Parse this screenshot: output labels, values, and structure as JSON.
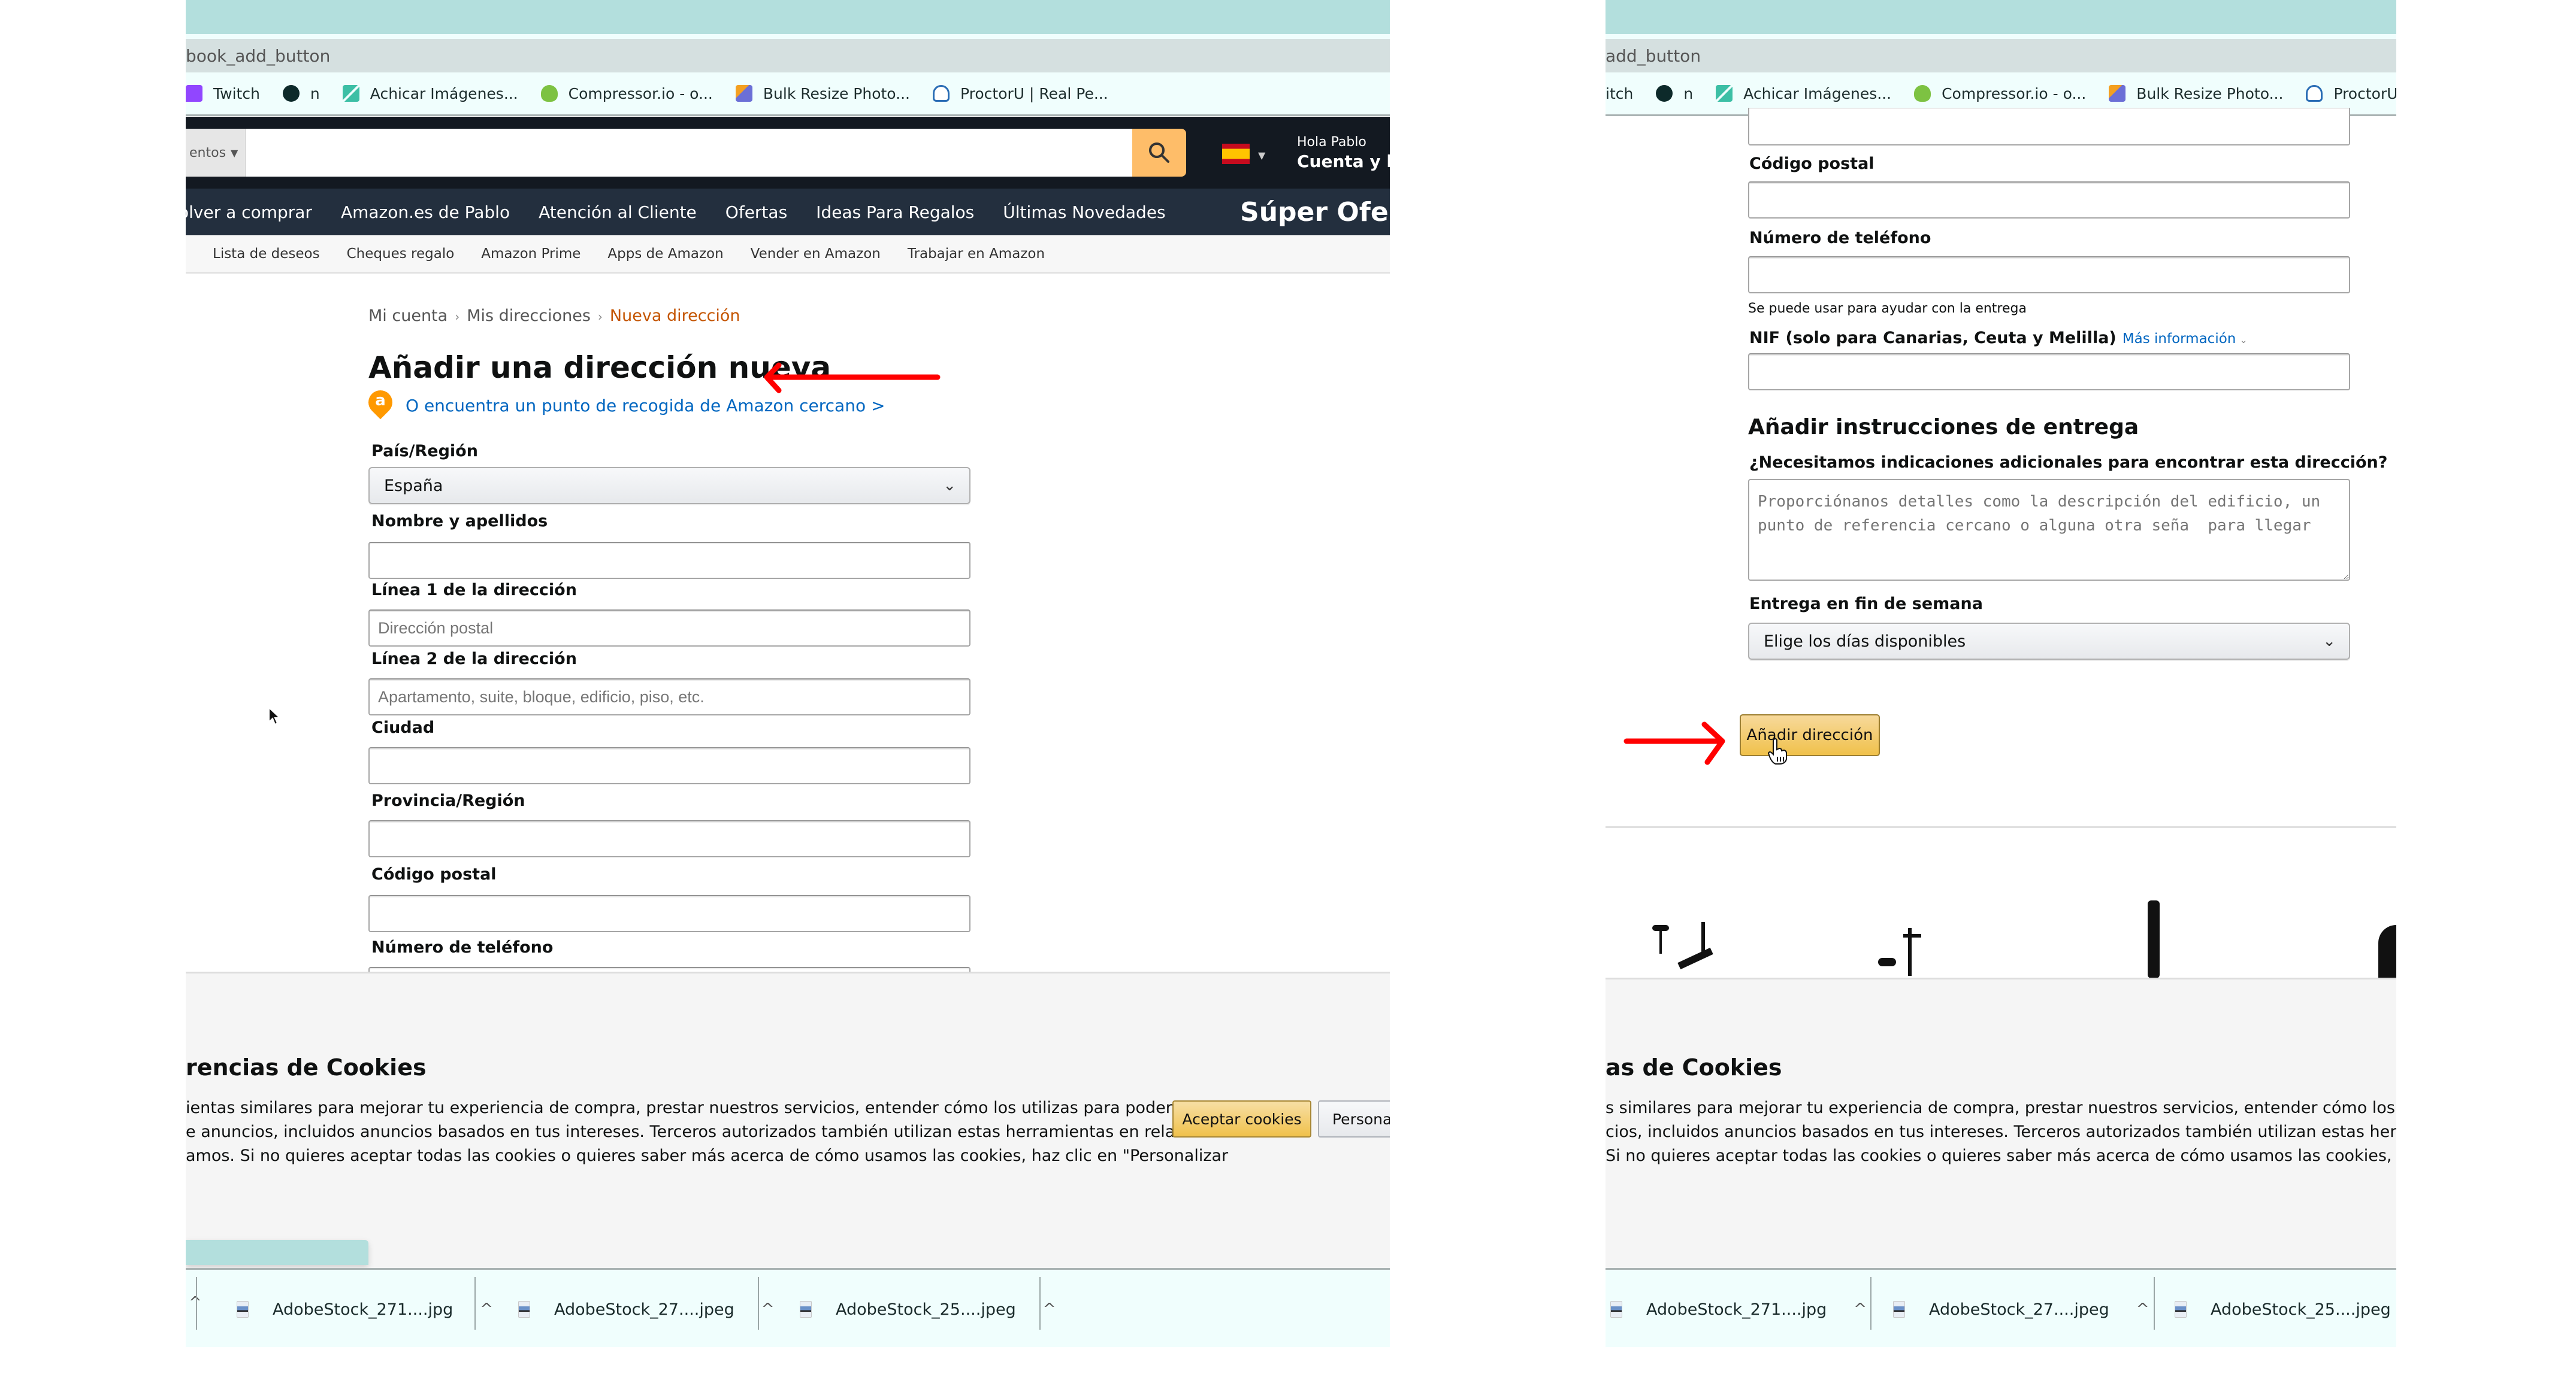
{
  "browser": {
    "url_fragment_left": "book_add_button",
    "url_fragment_right": "add_button",
    "bookmarks": [
      {
        "icon": "twitch-icon",
        "label": "Twitch"
      },
      {
        "icon": "globe-icon",
        "label": "n"
      },
      {
        "icon": "compress-arrows-icon",
        "label": "Achicar Imágenes..."
      },
      {
        "icon": "chameleon-icon",
        "label": "Compressor.io - o..."
      },
      {
        "icon": "stacked-pages-icon",
        "label": "Bulk Resize Photo..."
      },
      {
        "icon": "owl-icon",
        "label": "ProctorU | Real Pe..."
      }
    ],
    "bookmarks_right_first": "itch",
    "bookmarks_right_last": "ProctorU | Real"
  },
  "header": {
    "search_category": "entos",
    "search_placeholder": "",
    "greeting": "Hola Pablo",
    "account_label": "Cuenta y listas",
    "nav": [
      "olver a comprar",
      "Amazon.es de Pablo",
      "Atención al Cliente",
      "Ofertas",
      "Ideas Para Regalos",
      "Últimas Novedades"
    ],
    "promo": "Súper Ofertas",
    "subnav": [
      "Lista de deseos",
      "Cheques regalo",
      "Amazon Prime",
      "Apps de Amazon",
      "Vender en Amazon",
      "Trabajar en Amazon"
    ]
  },
  "breadcrumb": {
    "items": [
      "Mi cuenta",
      "Mis direcciones"
    ],
    "current": "Nueva dirección",
    "separator": "›"
  },
  "page": {
    "title": "Añadir una dirección nueva",
    "pickup_link": "O encuentra un punto de recogida de Amazon cercano >",
    "pickup_icon_letter": "a"
  },
  "form_left": {
    "country_label": "País/Región",
    "country_value": "España",
    "name_label": "Nombre y apellidos",
    "name_value": "",
    "address1_label": "Línea 1 de la dirección",
    "address1_placeholder": "Dirección postal",
    "address2_label": "Línea 2 de la dirección",
    "address2_placeholder": "Apartamento, suite, bloque, edificio, piso, etc.",
    "city_label": "Ciudad",
    "city_value": "",
    "province_label": "Provincia/Región",
    "province_value": "",
    "postal_label": "Código postal",
    "postal_value": "",
    "phone_label": "Número de teléfono"
  },
  "form_right": {
    "postal_label": "Código postal",
    "phone_label": "Número de teléfono",
    "phone_note": "Se puede usar para ayudar con la entrega",
    "nif_label": "NIF (solo para Canarias, Ceuta y Melilla)",
    "nif_more": "Más información",
    "instructions_title": "Añadir instrucciones de entrega",
    "instructions_question": "¿Necesitamos indicaciones adicionales para encontrar esta dirección?",
    "instructions_placeholder": "Proporciónanos detalles como la descripción del edificio, un punto de referencia cercano o alguna otra seña  para llegar",
    "weekend_label": "Entrega en fin de semana",
    "weekend_value": "Elige los días disponibles",
    "submit_label": "Añadir dirección"
  },
  "cookies": {
    "title_left": "rencias de Cookies",
    "title_right": "as de Cookies",
    "lines_left": [
      "ientas similares para mejorar tu experiencia de compra, prestar nuestros servicios, entender cómo los utilizas para poder",
      "e anuncios, incluidos anuncios basados en tus intereses. Terceros autorizados también utilizan estas herramientas en relación",
      "amos. Si no quieres aceptar todas las cookies o quieres saber más acerca de cómo usamos las cookies, haz clic en \"Personalizar"
    ],
    "lines_right": [
      "s similares para mejorar tu experiencia de compra, prestar nuestros servicios, entender cómo los utilizas p",
      "cios, incluidos anuncios basados en tus intereses. Terceros autorizados también utilizan estas herramient",
      "Si no quieres aceptar todas las cookies o quieres saber más acerca de cómo usamos las cookies, haz clic e"
    ],
    "accept_label": "Aceptar cookies",
    "customize_label": "Personalizar"
  },
  "downloads": [
    {
      "name": "AdobeStock_271....jpg"
    },
    {
      "name": "AdobeStock_27....jpeg"
    },
    {
      "name": "AdobeStock_25....jpeg"
    }
  ],
  "colors": {
    "header_bg": "#131921",
    "nav_bg": "#232f3e",
    "search_button": "#febd69",
    "link": "#0066c0",
    "breadcrumb_current": "#c45500",
    "primary_button": "#f0c14b",
    "annotation_arrow": "#ff0000",
    "chrome_teal": "#b3dfdd"
  }
}
